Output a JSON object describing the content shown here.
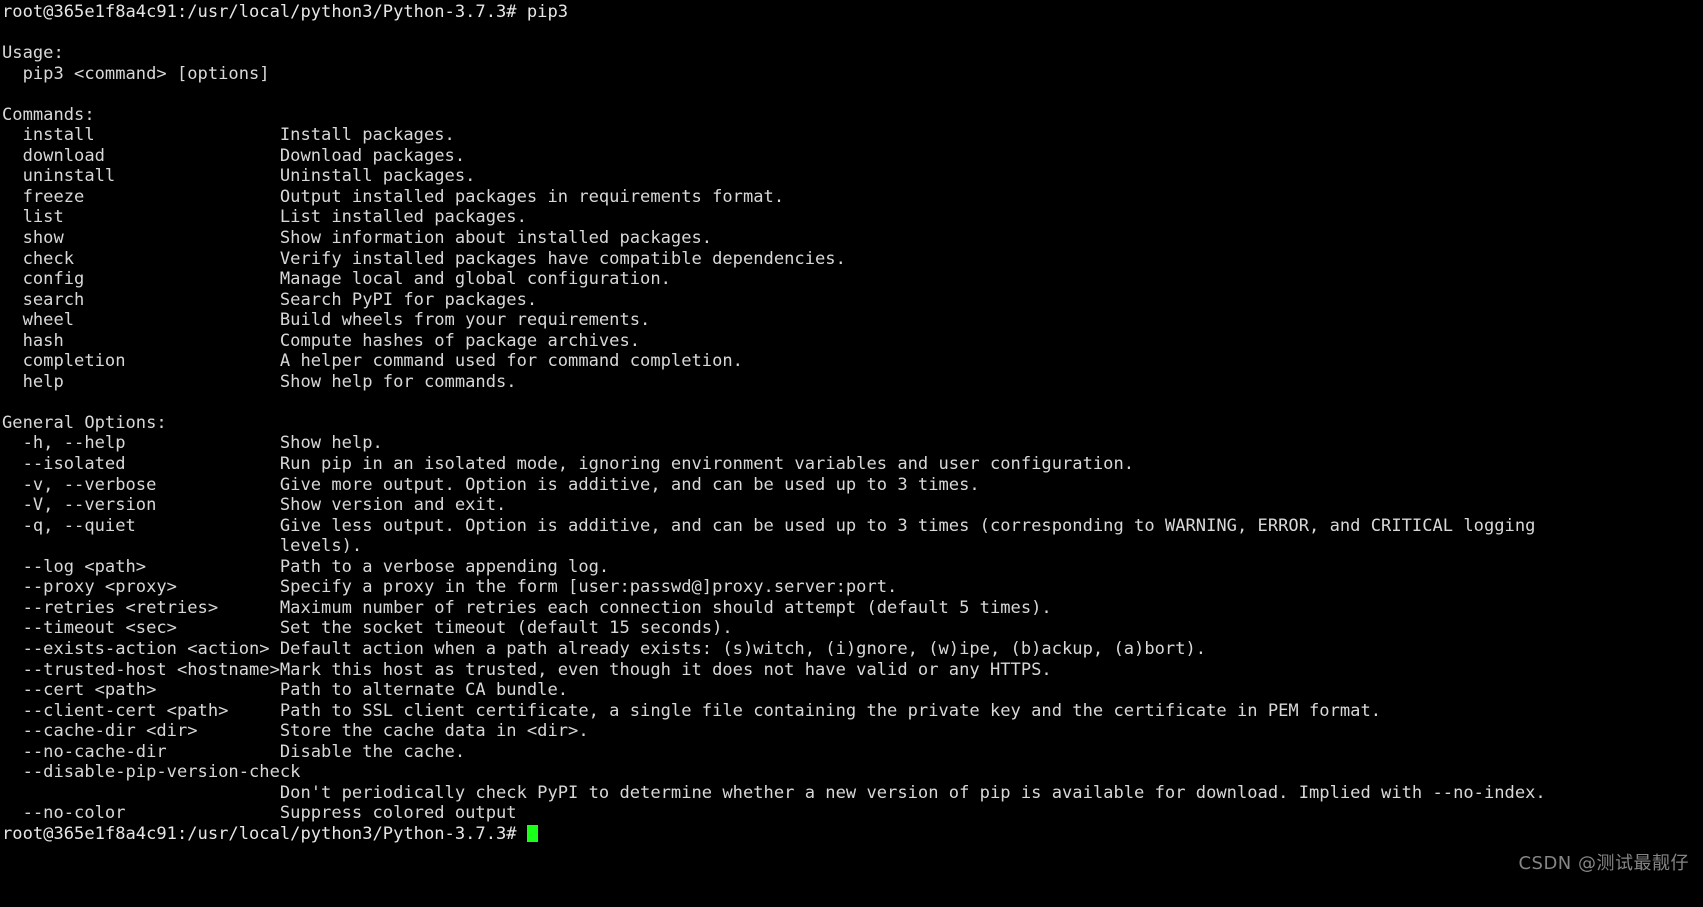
{
  "terminal": {
    "colors": {
      "background": "#000000",
      "foreground": "#d8d8d8",
      "prompt_foreground": "#e6e6e6",
      "cursor": "#1aff1a",
      "watermark": "#8d8d8d"
    },
    "command_prompt": "root@365e1f8a4c91:/usr/local/python3/Python-3.7.3# ",
    "command_entered": "pip3",
    "final_prompt": "root@365e1f8a4c91:/usr/local/python3/Python-3.7.3# ",
    "cursor_glyph": "block-cursor"
  },
  "output": {
    "usage_heading": "Usage:",
    "usage_line": "  pip3 <command> [options]",
    "commands_heading": "Commands:",
    "commands": [
      {
        "name": "install",
        "description": "Install packages."
      },
      {
        "name": "download",
        "description": "Download packages."
      },
      {
        "name": "uninstall",
        "description": "Uninstall packages."
      },
      {
        "name": "freeze",
        "description": "Output installed packages in requirements format."
      },
      {
        "name": "list",
        "description": "List installed packages."
      },
      {
        "name": "show",
        "description": "Show information about installed packages."
      },
      {
        "name": "check",
        "description": "Verify installed packages have compatible dependencies."
      },
      {
        "name": "config",
        "description": "Manage local and global configuration."
      },
      {
        "name": "search",
        "description": "Search PyPI for packages."
      },
      {
        "name": "wheel",
        "description": "Build wheels from your requirements."
      },
      {
        "name": "hash",
        "description": "Compute hashes of package archives."
      },
      {
        "name": "completion",
        "description": "A helper command used for command completion."
      },
      {
        "name": "help",
        "description": "Show help for commands."
      }
    ],
    "general_options_heading": "General Options:",
    "general_options": [
      {
        "flag": "-h, --help",
        "description": "Show help.",
        "continuation": ""
      },
      {
        "flag": "--isolated",
        "description": "Run pip in an isolated mode, ignoring environment variables and user configuration.",
        "continuation": ""
      },
      {
        "flag": "-v, --verbose",
        "description": "Give more output. Option is additive, and can be used up to 3 times.",
        "continuation": ""
      },
      {
        "flag": "-V, --version",
        "description": "Show version and exit.",
        "continuation": ""
      },
      {
        "flag": "-q, --quiet",
        "description": "Give less output. Option is additive, and can be used up to 3 times (corresponding to WARNING, ERROR, and CRITICAL logging",
        "continuation": "levels)."
      },
      {
        "flag": "--log <path>",
        "description": "Path to a verbose appending log.",
        "continuation": ""
      },
      {
        "flag": "--proxy <proxy>",
        "description": "Specify a proxy in the form [user:passwd@]proxy.server:port.",
        "continuation": ""
      },
      {
        "flag": "--retries <retries>",
        "description": "Maximum number of retries each connection should attempt (default 5 times).",
        "continuation": ""
      },
      {
        "flag": "--timeout <sec>",
        "description": "Set the socket timeout (default 15 seconds).",
        "continuation": ""
      },
      {
        "flag": "--exists-action <action>",
        "description": "Default action when a path already exists: (s)witch, (i)gnore, (w)ipe, (b)ackup, (a)bort).",
        "continuation": ""
      },
      {
        "flag": "--trusted-host <hostname>",
        "description": "Mark this host as trusted, even though it does not have valid or any HTTPS.",
        "continuation": ""
      },
      {
        "flag": "--cert <path>",
        "description": "Path to alternate CA bundle.",
        "continuation": ""
      },
      {
        "flag": "--client-cert <path>",
        "description": "Path to SSL client certificate, a single file containing the private key and the certificate in PEM format.",
        "continuation": ""
      },
      {
        "flag": "--cache-dir <dir>",
        "description": "Store the cache data in <dir>.",
        "continuation": ""
      },
      {
        "flag": "--no-cache-dir",
        "description": "Disable the cache.",
        "continuation": ""
      },
      {
        "flag": "--disable-pip-version-check",
        "description": "",
        "continuation": "Don't periodically check PyPI to determine whether a new version of pip is available for download. Implied with --no-index."
      },
      {
        "flag": "--no-color",
        "description": "Suppress colored output",
        "continuation": ""
      }
    ]
  },
  "watermark": {
    "text": "CSDN @测试最靓仔"
  }
}
